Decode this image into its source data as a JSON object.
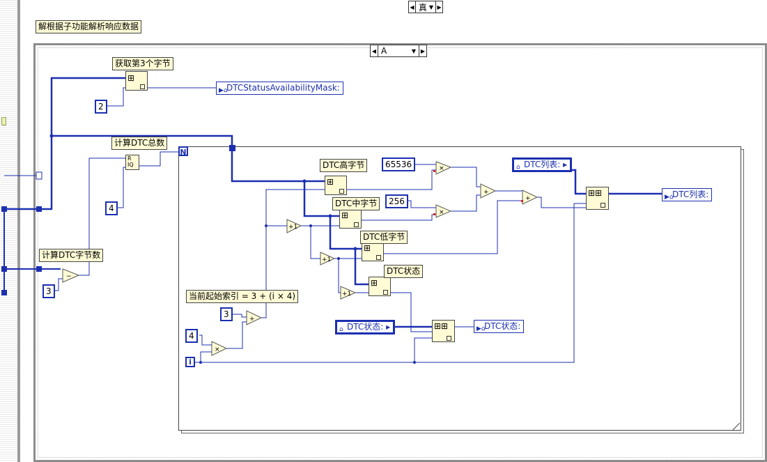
{
  "outer_case": {
    "selector_value": "真"
  },
  "inner_case": {
    "selector_value": "A"
  },
  "labels": {
    "main_title": "解根据子功能解析响应数据",
    "get_byte3": "获取第3个字节",
    "calc_total": "计算DTC总数",
    "calc_bytes": "计算DTC字节数",
    "dtc_high": "DTC高字节",
    "dtc_mid": "DTC中字节",
    "dtc_low": "DTC低字节",
    "dtc_status": "DTC状态",
    "start_index": "当前起始索引 = 3 + (i × 4)"
  },
  "constants": {
    "c2": "2",
    "c4a": "4",
    "c3a": "3",
    "c65536": "65536",
    "c256": "256",
    "c3b": "3",
    "c4b": "4"
  },
  "refs": {
    "mask": "DTCStatusAvailabilityMask:",
    "dtc_list_in": "DTC列表:",
    "dtc_list_out": "DTC列表:",
    "dtc_status_in": "DTC状态:",
    "dtc_status_out": "DTC状态:"
  },
  "loop": {
    "count_terminal": "N",
    "iteration_terminal": "i"
  },
  "operators": {
    "subtract": "−",
    "multiply": "×",
    "add": "+",
    "increment": "+1",
    "quotient": "R IQ"
  },
  "colors": {
    "wire": "#1b2fb0",
    "node_fill": "#fffbd5",
    "frame": "#8c8c8c"
  }
}
